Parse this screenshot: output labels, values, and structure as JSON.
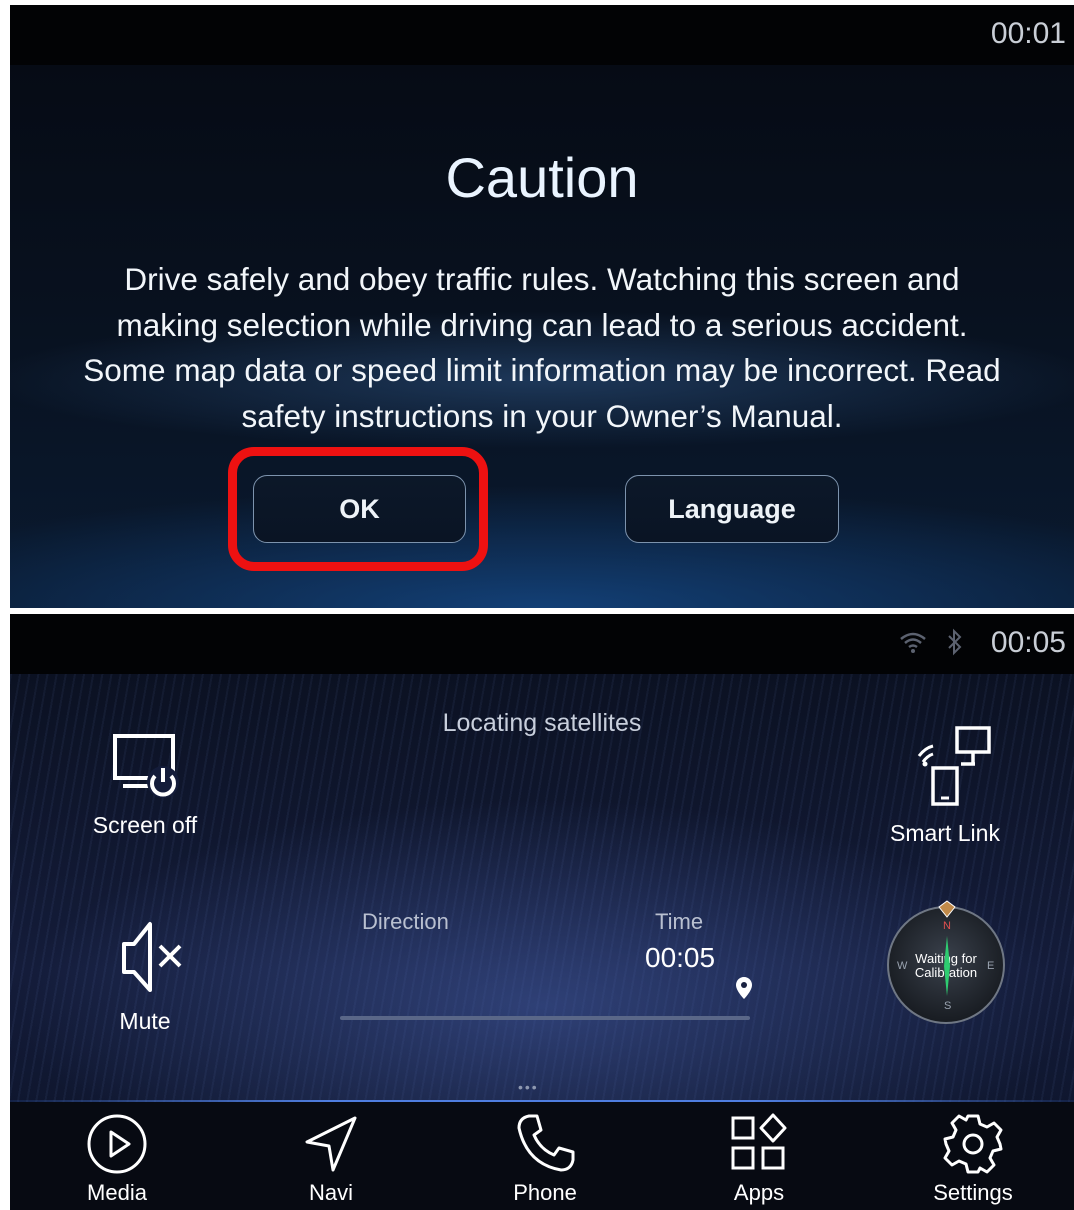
{
  "caution_screen": {
    "clock": "00:01",
    "title": "Caution",
    "message": "Drive safely and obey traffic rules. Watching this screen and making selection while driving can lead to a serious accident. Some map data or speed limit information may be incorrect. Read safety instructions in your Owner’s Manual.",
    "ok_label": "OK",
    "language_label": "Language",
    "highlight_color": "#ee1111"
  },
  "home_screen": {
    "clock": "00:05",
    "status_icons": [
      "wifi-icon",
      "bluetooth-icon"
    ],
    "locating_text": "Locating satellites",
    "quick_actions": {
      "screen_off": "Screen off",
      "smart_link": "Smart Link",
      "mute": "Mute"
    },
    "direction_label": "Direction",
    "time_label": "Time",
    "time_value": "00:05",
    "compass": {
      "text": "Waiting for Calibration",
      "north": "N",
      "south": "S",
      "east": "E",
      "west": "W"
    },
    "dock": [
      {
        "label": "Media",
        "icon": "play-circle-icon"
      },
      {
        "label": "Navi",
        "icon": "navigation-arrow-icon"
      },
      {
        "label": "Phone",
        "icon": "phone-icon"
      },
      {
        "label": "Apps",
        "icon": "apps-grid-icon"
      },
      {
        "label": "Settings",
        "icon": "gear-icon"
      }
    ]
  }
}
